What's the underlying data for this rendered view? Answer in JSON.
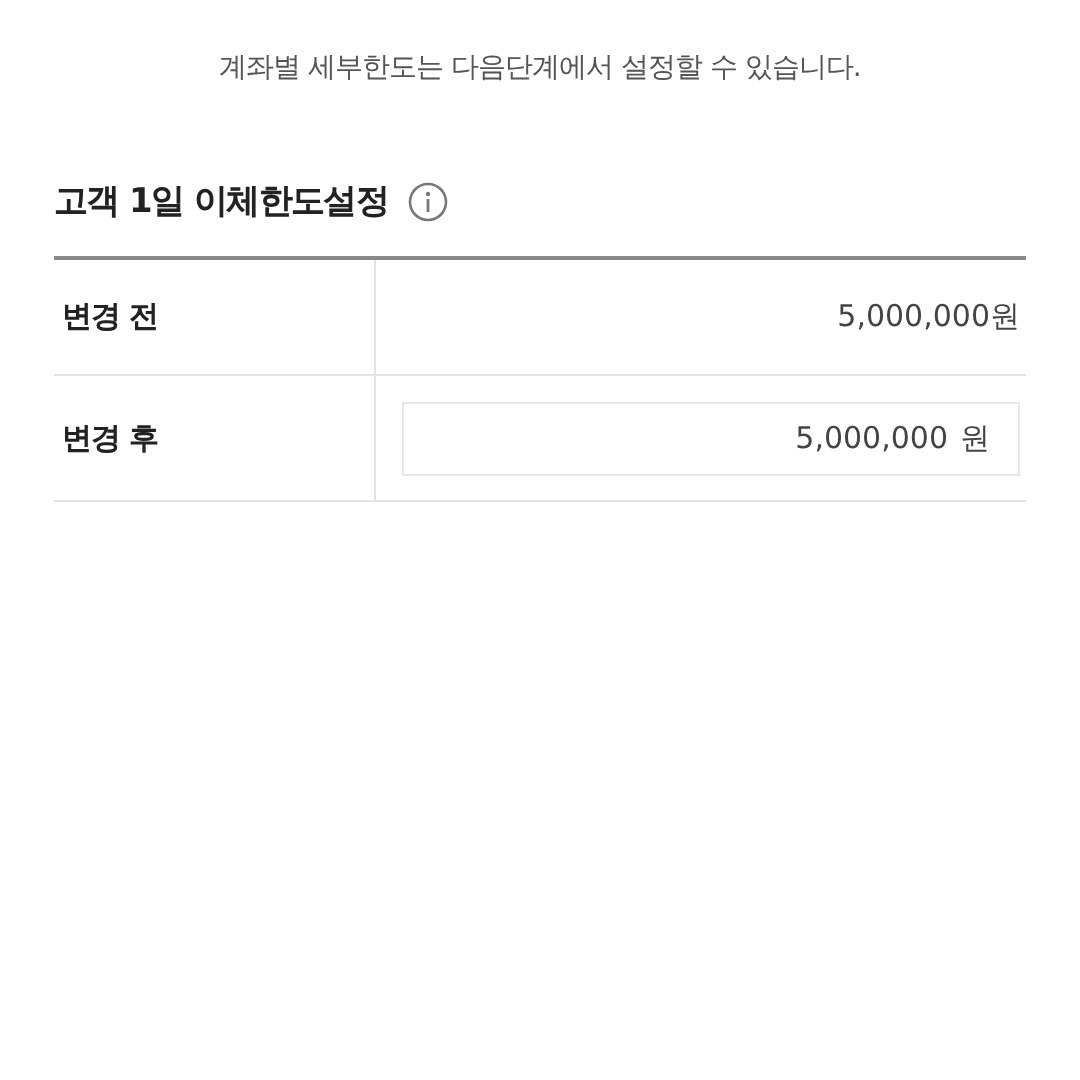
{
  "notice": "계좌별 세부한도는 다음단계에서 설정할 수 있습니다.",
  "section": {
    "title": "고객 1일 이체한도설정"
  },
  "rows": [
    {
      "kind": "text",
      "label": "변경 전",
      "value": "5,000,000원"
    },
    {
      "kind": "input",
      "label": "변경 후",
      "value": "5,000,000",
      "unit": "원"
    }
  ]
}
